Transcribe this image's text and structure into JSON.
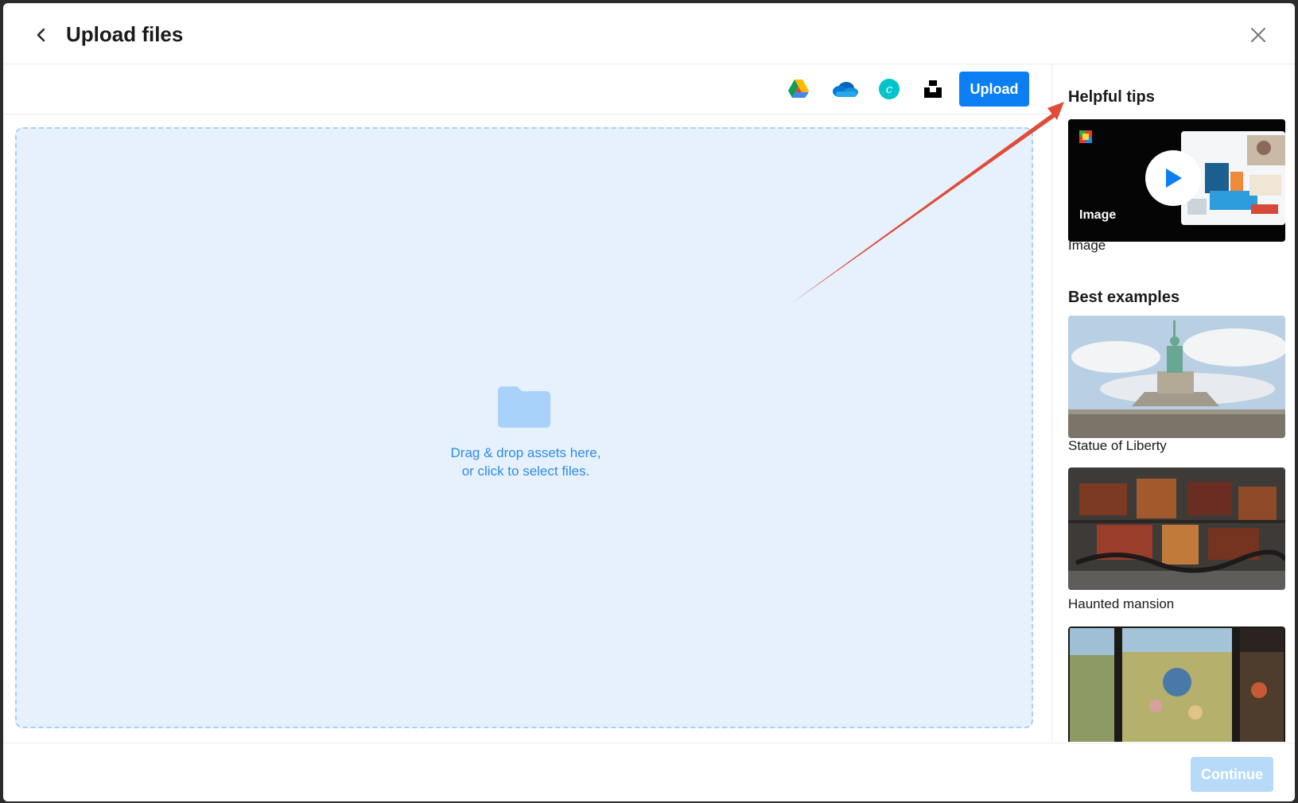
{
  "header": {
    "title": "Upload files",
    "back_icon": "chevron-left-icon",
    "close_icon": "close-icon"
  },
  "toolbar": {
    "sources": [
      {
        "name": "Google Drive",
        "icon": "google-drive-icon"
      },
      {
        "name": "OneDrive",
        "icon": "onedrive-icon"
      },
      {
        "name": "Canva",
        "icon": "canva-icon"
      },
      {
        "name": "Unsplash",
        "icon": "unsplash-icon"
      }
    ],
    "upload_label": "Upload",
    "accent": "#0b7ef3"
  },
  "dropzone": {
    "icon": "folder-icon",
    "line1": "Drag & drop assets here,",
    "line2": "or click to select files."
  },
  "sidebar": {
    "tips_title": "Helpful tips",
    "tip_video": {
      "overlay_label": "Image",
      "caption": "Image",
      "icon": "play-icon"
    },
    "examples_title": "Best examples",
    "examples": [
      {
        "caption": "Statue of Liberty"
      },
      {
        "caption": "Haunted mansion"
      },
      {
        "caption": ""
      }
    ]
  },
  "footer": {
    "continue_label": "Continue"
  },
  "annotation": {
    "color": "#e04b3a"
  }
}
